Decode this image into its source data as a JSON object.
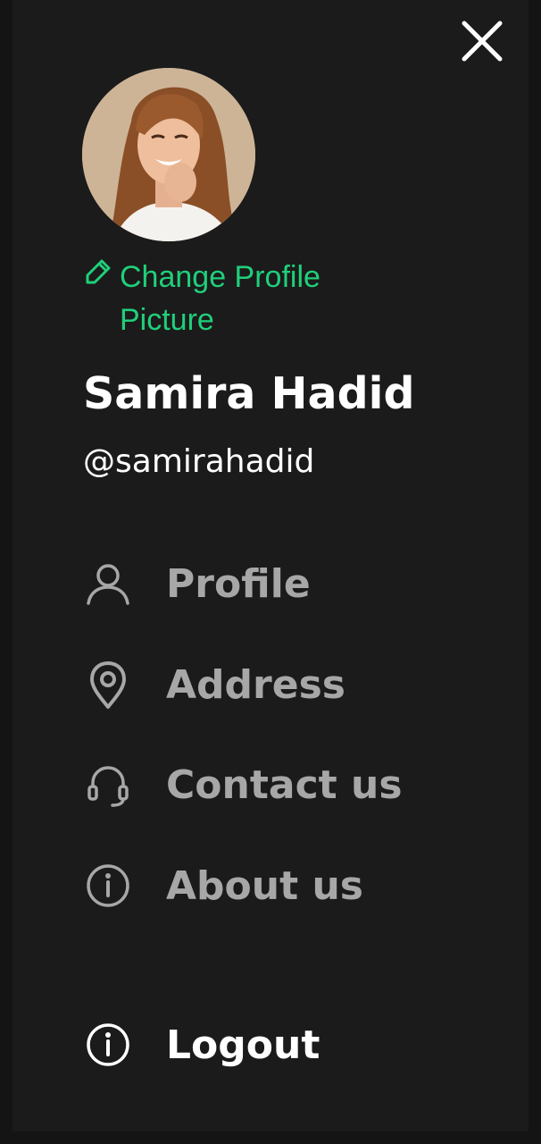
{
  "drawer": {
    "change_photo_label": "Change Profile Picture",
    "user": {
      "name": "Samira Hadid",
      "handle": "@samirahadid"
    },
    "menu": [
      {
        "label": "Profile",
        "icon": "user-icon"
      },
      {
        "label": "Address",
        "icon": "location-pin-icon"
      },
      {
        "label": "Contact us",
        "icon": "headset-icon"
      },
      {
        "label": "About us",
        "icon": "info-icon"
      }
    ],
    "logout_label": "Logout",
    "icons": {
      "close": "close-icon",
      "edit": "edit-icon",
      "logout": "info-icon"
    }
  },
  "colors": {
    "background": "#1b1b1b",
    "accent": "#20cf7a",
    "menu_text": "#a7a7a7",
    "primary_text": "#ffffff"
  }
}
